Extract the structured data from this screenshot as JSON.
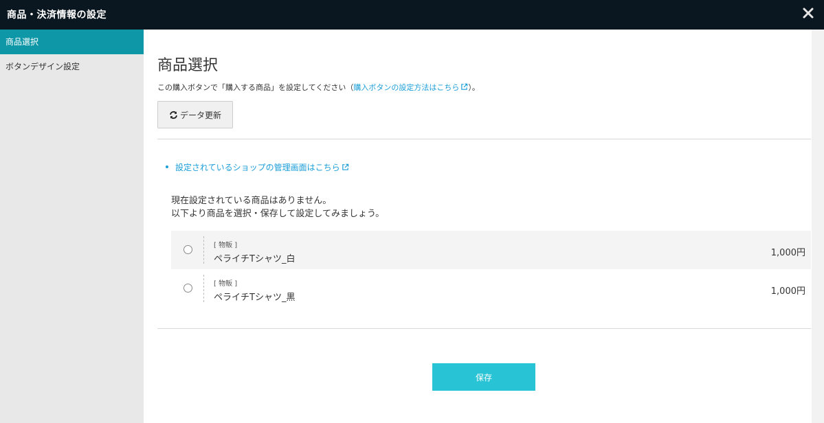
{
  "window": {
    "title": "商品・決済情報の設定"
  },
  "sidebar": {
    "items": [
      {
        "label": "商品選択"
      },
      {
        "label": "ボタンデザイン設定"
      }
    ]
  },
  "main": {
    "title": "商品選択",
    "description_prefix": "この購入ボタンで「購入する商品」を設定してください（",
    "description_link": "購入ボタンの設定方法はこちら",
    "description_suffix": "）。",
    "refresh_label": "データ更新",
    "shop_link": "設定されているショップの管理画面はこちら",
    "message_line1": "現在設定されている商品はありません。",
    "message_line2": "以下より商品を選択・保存して設定してみましょう。",
    "products": [
      {
        "category": "[ 物販 ]",
        "name": "ペライチTシャツ_白",
        "price": "1,000円"
      },
      {
        "category": "[ 物販 ]",
        "name": "ペライチTシャツ_黒",
        "price": "1,000円"
      }
    ],
    "save_label": "保存"
  },
  "colors": {
    "titlebar": "#0b1720",
    "sidebar_active": "#0d97a7",
    "link": "#1a9ed8",
    "save_button": "#28c3d4"
  },
  "icons": [
    "close-icon",
    "external-link-icon",
    "refresh-icon"
  ]
}
